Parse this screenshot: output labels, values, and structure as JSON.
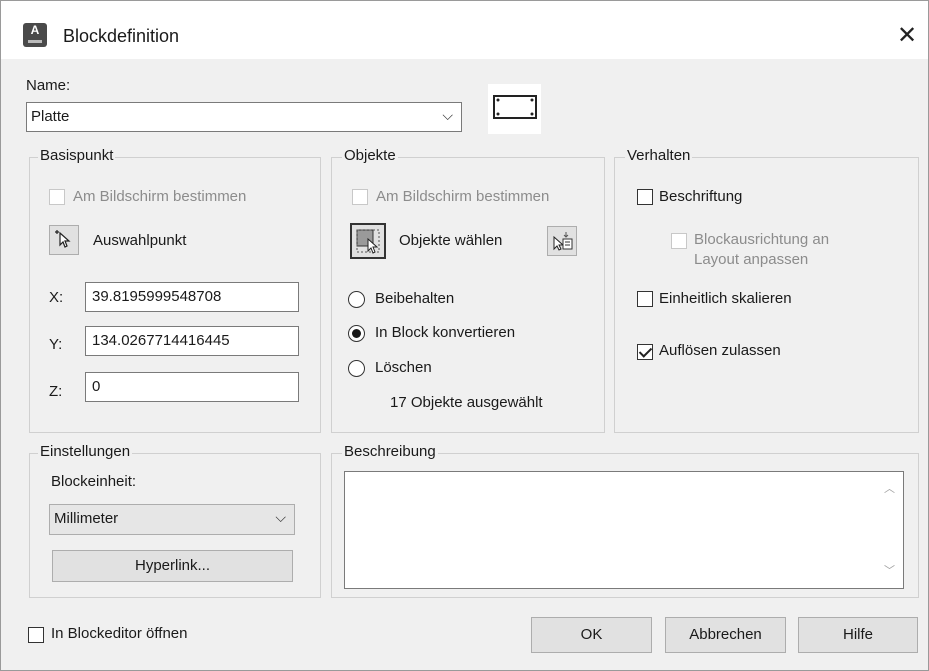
{
  "window": {
    "title": "Blockdefinition",
    "app_icon_letter": "A"
  },
  "name": {
    "label": "Name:",
    "value": "Platte"
  },
  "basispunkt": {
    "title": "Basispunkt",
    "on_screen": "Am Bildschirm bestimmen",
    "pick_button": "Auswahlpunkt",
    "x_label": "X:",
    "x_value": "39.8195999548708",
    "y_label": "Y:",
    "y_value": "134.0267714416445",
    "z_label": "Z:",
    "z_value": "0"
  },
  "objekte": {
    "title": "Objekte",
    "on_screen": "Am Bildschirm bestimmen",
    "select_button": "Objekte wählen",
    "options": [
      "Beibehalten",
      "In Block konvertieren",
      "Löschen"
    ],
    "selected_option": "In Block konvertieren",
    "status": "17 Objekte ausgewählt"
  },
  "verhalten": {
    "title": "Verhalten",
    "annotative": "Beschriftung",
    "annotative_checked": false,
    "orientation_line1": "Blockausrichtung an",
    "orientation_line2": "Layout anpassen",
    "uniform_scale": "Einheitlich skalieren",
    "uniform_scale_checked": false,
    "allow_explode": "Auflösen zulassen",
    "allow_explode_checked": true
  },
  "einstellungen": {
    "title": "Einstellungen",
    "unit_label": "Blockeinheit:",
    "unit_value": "Millimeter",
    "hyperlink_button": "Hyperlink..."
  },
  "beschreibung": {
    "title": "Beschreibung",
    "value": ""
  },
  "footer": {
    "open_in_editor": "In Blockeditor öffnen",
    "ok": "OK",
    "cancel": "Abbrechen",
    "help": "Hilfe"
  }
}
